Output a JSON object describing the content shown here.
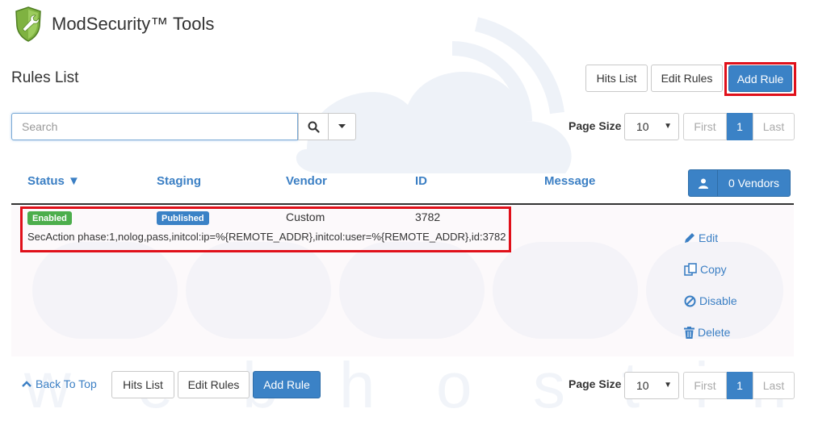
{
  "header": {
    "title": "ModSecurity™ Tools",
    "logo_icon": "shield-wrench-icon"
  },
  "rules_list": {
    "title": "Rules List"
  },
  "toolbar": {
    "hits_list": "Hits List",
    "edit_rules": "Edit Rules",
    "add_rule": "Add Rule"
  },
  "search": {
    "placeholder": "Search",
    "value": ""
  },
  "page_size": {
    "label": "Page Size",
    "value": "10"
  },
  "pagination": {
    "first": "First",
    "current": "1",
    "last": "Last"
  },
  "table": {
    "columns": {
      "status": "Status ▼",
      "staging": "Staging",
      "vendor": "Vendor",
      "id": "ID",
      "message": "Message"
    },
    "vendors_button": "0 Vendors",
    "rows": [
      {
        "status": "Enabled",
        "staging": "Published",
        "vendor": "Custom",
        "id": "3782",
        "rule": "SecAction phase:1,nolog,pass,initcol:ip=%{REMOTE_ADDR},initcol:user=%{REMOTE_ADDR},id:3782",
        "actions": {
          "edit": "Edit",
          "copy": "Copy",
          "disable": "Disable",
          "delete": "Delete"
        }
      }
    ]
  },
  "footer": {
    "back_to_top": "Back To Top",
    "hits_list": "Hits List",
    "edit_rules": "Edit Rules",
    "add_rule": "Add Rule"
  },
  "colors": {
    "primary": "#3b82c6",
    "success": "#4cae4c",
    "highlight": "#e0101a",
    "link": "#3b7fc4"
  }
}
